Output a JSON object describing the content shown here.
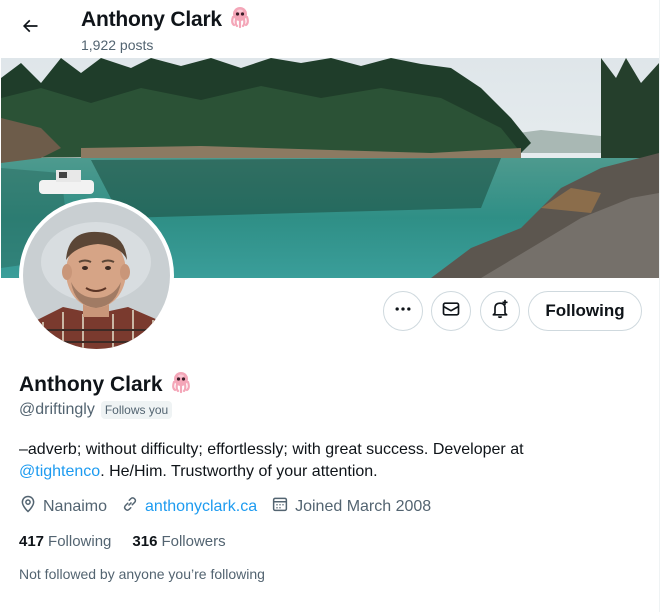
{
  "header": {
    "name": "Anthony Clark",
    "emoji": "🐙",
    "posts_count": "1,922 posts"
  },
  "actions": {
    "more_icon": "more-horizontal-icon",
    "message_icon": "envelope-icon",
    "notify_icon": "bell-plus-icon",
    "following_label": "Following"
  },
  "profile": {
    "name": "Anthony Clark",
    "emoji": "🐙",
    "handle": "@driftingly",
    "follows_you": "Follows you",
    "bio_text_1": "–adverb; without difficulty; effortlessly; with great success. Developer at",
    "bio_mention": "@tightenco",
    "bio_text_2": ". He/Him. Trustworthy of your attention.",
    "location": "Nanaimo",
    "website": "anthonyclark.ca",
    "joined": "Joined March 2008",
    "following_count": "417",
    "following_label": "Following",
    "followers_count": "316",
    "followers_label": "Followers",
    "not_followed_text": "Not followed by anyone you’re following"
  },
  "colors": {
    "text_primary": "#0f1419",
    "text_secondary": "#536471",
    "link": "#1d9bf0",
    "border": "#cfd9de",
    "badge_bg": "#eff3f4"
  }
}
